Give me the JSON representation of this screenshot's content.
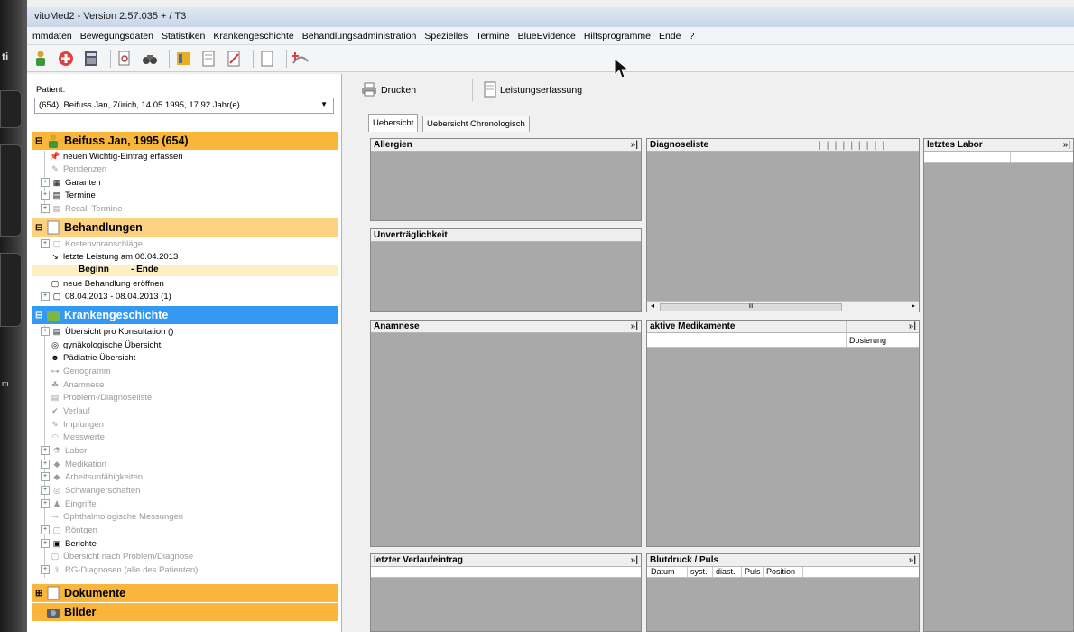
{
  "window": {
    "title": "vitoMed2  -  Version 2.57.035 + / T3"
  },
  "menu": [
    "mmdaten",
    "Bewegungsdaten",
    "Statistiken",
    "Krankengeschichte",
    "Behandlungsadministration",
    "Spezielles",
    "Termine",
    "BlueEvidence",
    "Hilfsprogramme",
    "Ende",
    "?"
  ],
  "toolbar_icons": [
    "patient-icon",
    "add-icon",
    "calculator-icon",
    "document-search-icon",
    "binoculars-icon",
    "book-icon",
    "form-icon",
    "edit-icon",
    "page-icon",
    "add-treatment-icon"
  ],
  "device": {
    "left_text": "ti",
    "left_text2": "m"
  },
  "patient": {
    "label": "Patient:",
    "selected": "(654), Beifuss Jan, Zürich, 14.05.1995, 17.92 Jahr(e)"
  },
  "tree": {
    "patient_header": "Beifuss Jan, 1995 (654)",
    "patient_items": [
      "neuen Wichtig-Eintrag erfassen",
      "Pendenzen",
      "Garanten",
      "Termine",
      "Recall-Termine"
    ],
    "behandlungen_header": "Behandlungen",
    "behandlungen_items": [
      "Kostenvoranschläge",
      "letzte Leistung am 08.04.2013"
    ],
    "beginn": "Beginn",
    "ende": "- Ende",
    "behandlungen_items2": [
      "neue Behandlung eröffnen",
      "08.04.2013 - 08.04.2013  (1)"
    ],
    "kg_header": "Krankengeschichte",
    "kg_items": [
      "Übersicht pro Konsultation ()",
      "gynäkologische Übersicht",
      "Pädiatrie Übersicht",
      "Genogramm",
      "Anamnese",
      "Problem-/Diagnoseliste",
      "Verlauf",
      "Impfungen",
      "Messwerte",
      "Labor",
      "Medikation",
      "Arbeitsunfähigkeiten",
      "Schwangerschaften",
      "Eingriffe",
      "Ophthalmologische Messungen",
      "Röntgen",
      "Berichte",
      "Übersicht nach Problem/Diagnose",
      "RG-Diagnosen (alle des Patienten)"
    ],
    "dokumente_header": "Dokumente",
    "bilder_header": "Bilder"
  },
  "right_toolbar": {
    "print": "Drucken",
    "services": "Leistungserfassung"
  },
  "tabs": [
    "Uebersicht",
    "Uebersicht Chronologisch"
  ],
  "panels": {
    "allergien": "Allergien",
    "unvertraeglichkeit": "Unverträglichkeit",
    "diagnoseliste": "Diagnoseliste",
    "letztes_labor": "letztes Labor",
    "anamnese": "Anamnese",
    "aktive_medikamente": "aktive Medikamente",
    "dosierung": "Dosierung",
    "letzter_verlaufeintrag": "letzter Verlaufeintrag",
    "blutdruck": "Blutdruck / Puls",
    "blutdruck_cols": [
      "Datum",
      "syst.",
      "diast.",
      "Puls",
      "Position"
    ],
    "more": "»|",
    "scroll_mark": "III"
  }
}
